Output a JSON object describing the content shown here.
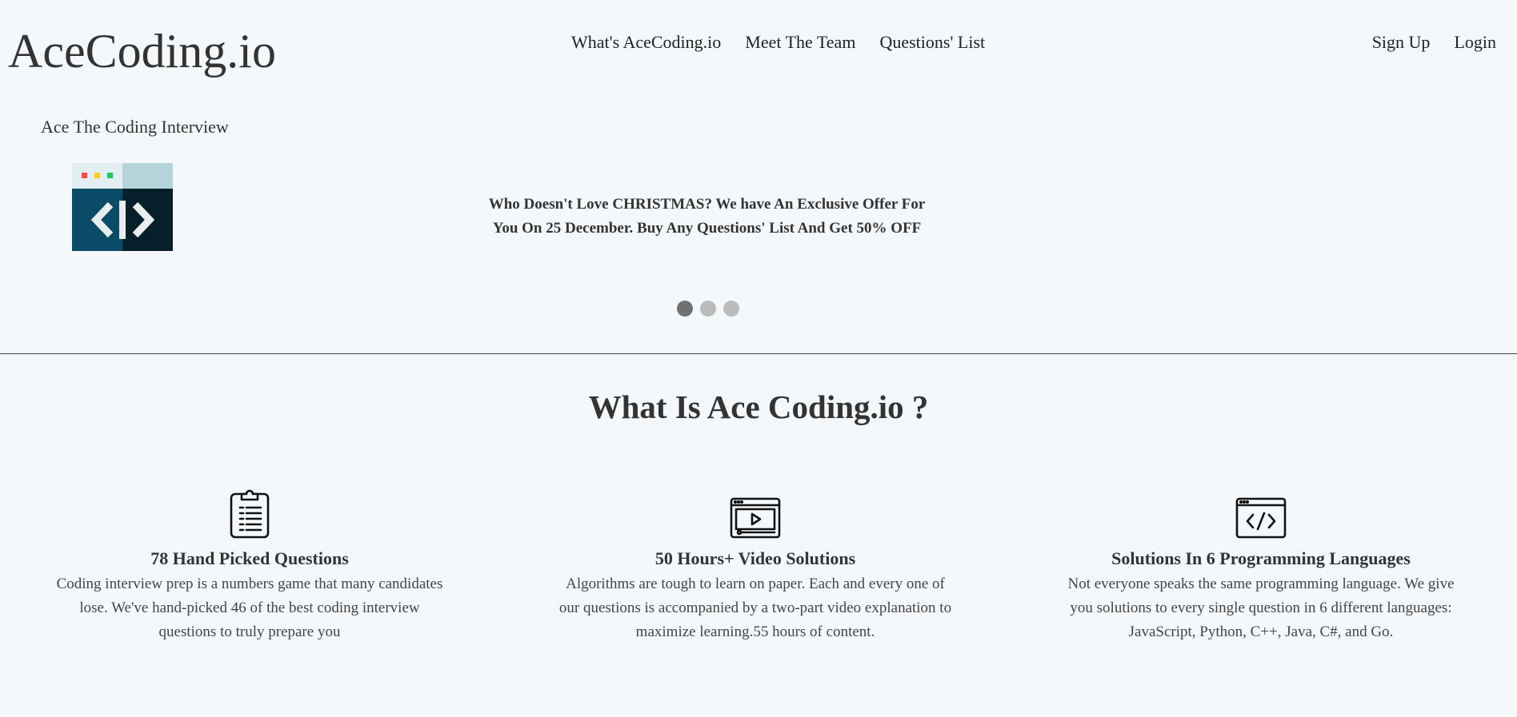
{
  "header": {
    "logo": "AceCoding.io",
    "nav_center": [
      "What's AceCoding.io",
      "Meet The Team",
      "Questions' List"
    ],
    "nav_right": [
      "Sign Up",
      "Login"
    ]
  },
  "hero": {
    "tagline": "Ace The Coding Interview",
    "icon": "code-window-icon",
    "slide_text": "Who Doesn't Love CHRISTMAS? We have An Exclusive Offer For You On 25 December. Buy Any Questions' List And Get 50% OFF",
    "slides_total": 3,
    "active_slide": 1
  },
  "about": {
    "title": "What Is Ace Coding.io ?",
    "features": [
      {
        "icon": "clipboard-list-icon",
        "title": "78 Hand Picked Questions",
        "text": "Coding interview prep is a numbers game that many candidates lose. We've hand-picked 46 of the best coding interview questions to truly prepare you"
      },
      {
        "icon": "video-player-icon",
        "title": "50 Hours+ Video Solutions",
        "text": "Algorithms are tough to learn on paper. Each and every one of our questions is accompanied by a two-part video explanation to maximize learning.55 hours of content."
      },
      {
        "icon": "code-browser-icon",
        "title": "Solutions In 6 Programming Languages",
        "text": "Not everyone speaks the same programming language. We give you solutions to every single question in 6 different languages: JavaScript, Python, C++, Java, C#, and Go."
      }
    ]
  },
  "colors": {
    "background": "#f4f8fb",
    "text": "#333333",
    "dot_active": "#717171",
    "dot_inactive": "#bbbbbb"
  }
}
